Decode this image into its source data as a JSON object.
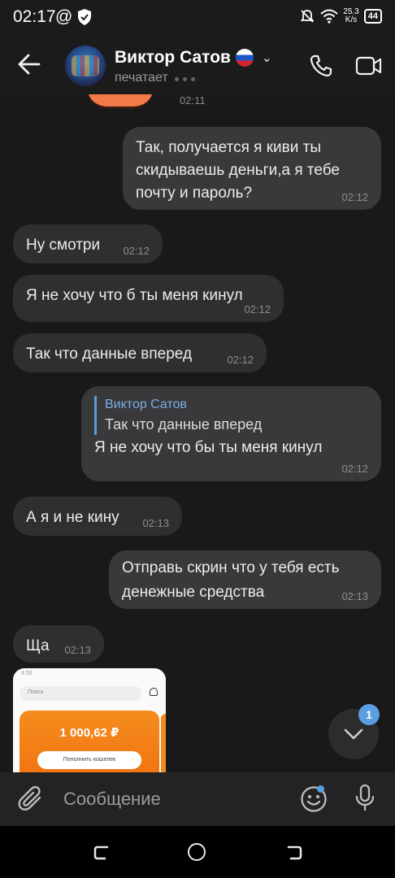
{
  "status_bar": {
    "time": "02:17",
    "at_sign": "@",
    "net_speed_top": "25.3",
    "net_speed_unit": "K/s",
    "battery": "44"
  },
  "header": {
    "contact_name": "Виктор Сатов",
    "status": "печатает"
  },
  "sticker_time": "02:11",
  "messages": [
    {
      "dir": "out",
      "text": "Так, получается я киви ты скидываешь деньги,а я тебе почту и пароль?",
      "time": "02:12"
    },
    {
      "dir": "in",
      "text": "Ну смотри",
      "time": "02:12"
    },
    {
      "dir": "in",
      "text": "Я не хочу что б ты меня кинул",
      "time": "02:12"
    },
    {
      "dir": "in",
      "text": "Так что данные вперед",
      "time": "02:12"
    },
    {
      "dir": "out",
      "reply_name": "Виктор Сатов",
      "reply_text": "Так что данные вперед",
      "text": "Я не хочу что бы ты меня кинул",
      "time": "02:12"
    },
    {
      "dir": "in",
      "text": "А я и не кину",
      "time": "02:13"
    },
    {
      "dir": "out",
      "text": "Отправь скрин что у тебя есть денежные средства",
      "time": "02:13"
    },
    {
      "dir": "in",
      "text": "Ща",
      "time": "02:13"
    }
  ],
  "image_preview": {
    "search_placeholder": "Поиск",
    "amount": "1 000,62 ₽",
    "topup_label": "Пополнить кошелек",
    "mini_time": "4:59"
  },
  "scroll_badge": "1",
  "composer": {
    "placeholder": "Сообщение"
  },
  "colors": {
    "accent": "#5a9ee0",
    "bubble_in": "#2f2f30",
    "bubble_out": "#39393b",
    "background": "#19191a"
  }
}
